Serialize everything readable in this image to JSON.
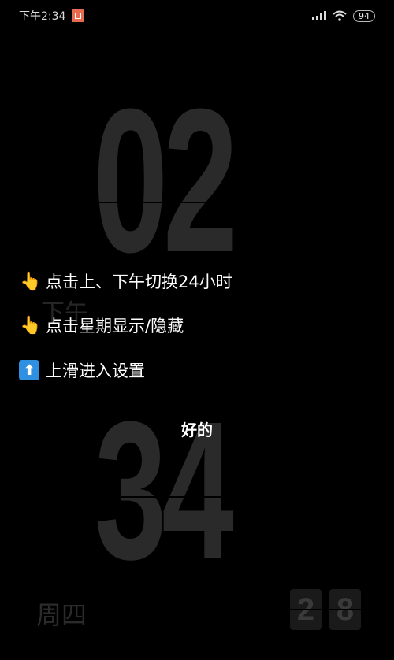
{
  "status_bar": {
    "time": "下午2:34",
    "notification_icon": "app-notification-icon",
    "battery": "94",
    "signal_label": "4G",
    "wifi_icon": "wifi-icon"
  },
  "clock": {
    "hour": "02",
    "minute": "34",
    "ampm": "下午",
    "weekday": "周四",
    "seconds": [
      "2",
      "8"
    ]
  },
  "tips": [
    {
      "icon": "pointing-hand-icon",
      "glyph": "👆",
      "text": "点击上、下午切换24小时"
    },
    {
      "icon": "pointing-hand-icon",
      "glyph": "👆",
      "text": "点击星期显示/隐藏"
    },
    {
      "icon": "arrow-up-icon",
      "glyph": "⬆",
      "text": "上滑进入设置"
    }
  ],
  "ok_label": "好的"
}
